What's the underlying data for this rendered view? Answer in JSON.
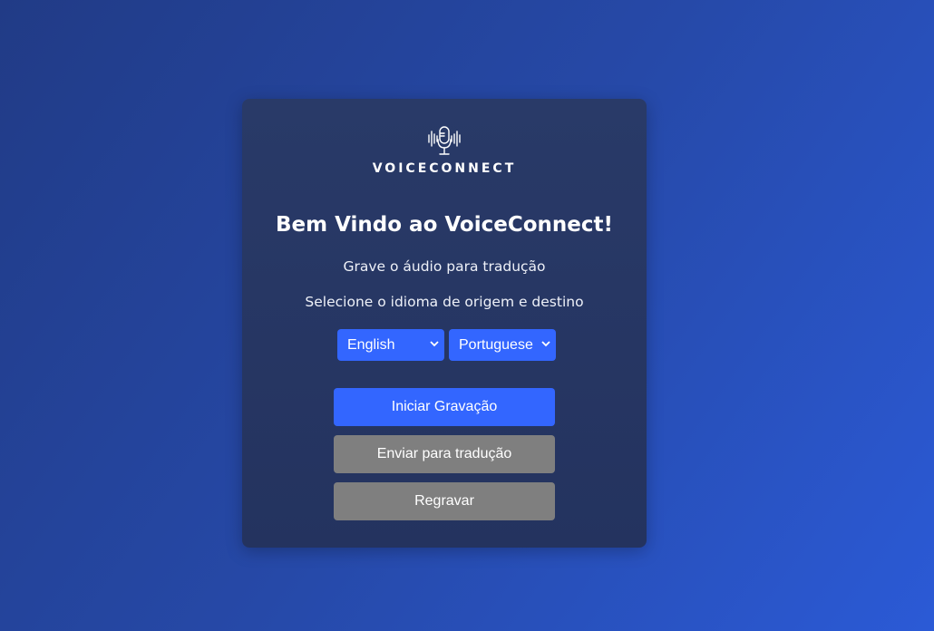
{
  "app": {
    "logo_text": "VOICECONNECT",
    "logo_icon": "microphone-soundwave-icon"
  },
  "welcome": {
    "title": "Bem Vindo ao VoiceConnect!",
    "line1": "Grave o áudio para tradução",
    "line2": "Selecione o idioma de origem e destino"
  },
  "languages": {
    "source": "English",
    "target": "Portuguese"
  },
  "actions": {
    "record_label": "Iniciar Gravação",
    "send_label": "Enviar para tradução",
    "rerecord_label": "Regravar"
  },
  "colors": {
    "accent": "#3366ff",
    "disabled": "#7f7f7f",
    "card": "#283965"
  }
}
